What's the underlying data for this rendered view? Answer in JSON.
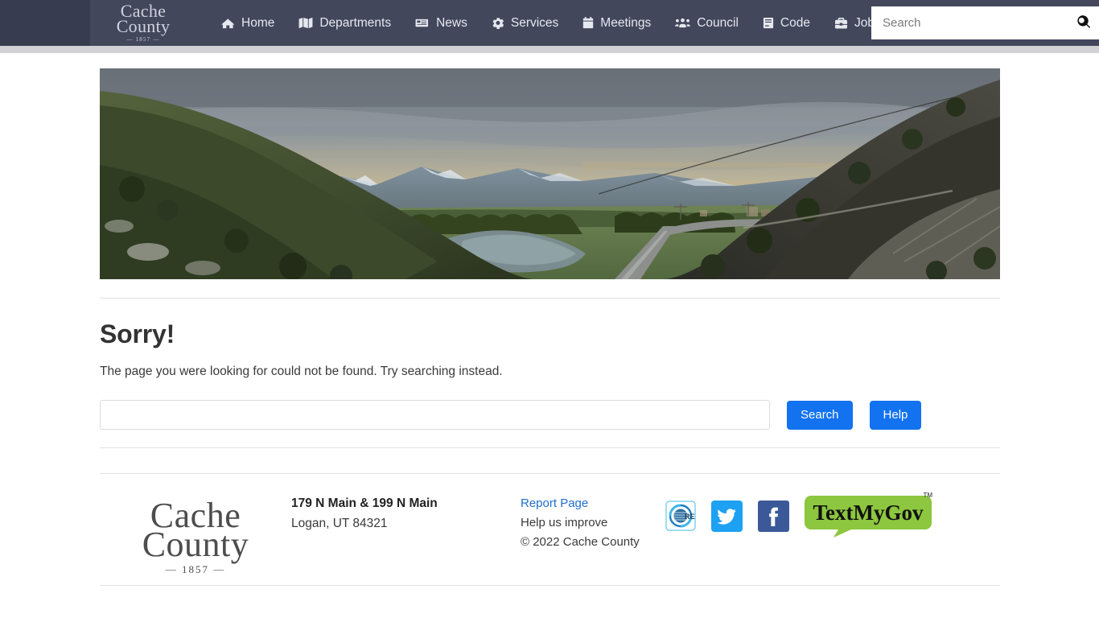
{
  "site": {
    "brand_line1": "Cache",
    "brand_line2": "County",
    "brand_year": "— 1857 —"
  },
  "nav": {
    "items": [
      {
        "label": "Home",
        "icon": "home-icon"
      },
      {
        "label": "Departments",
        "icon": "map-icon"
      },
      {
        "label": "News",
        "icon": "newspaper-icon"
      },
      {
        "label": "Services",
        "icon": "gear-icon"
      },
      {
        "label": "Meetings",
        "icon": "calendar-icon"
      },
      {
        "label": "Council",
        "icon": "users-icon"
      },
      {
        "label": "Code",
        "icon": "book-icon"
      },
      {
        "label": "Jobs",
        "icon": "briefcase-icon"
      }
    ],
    "search": {
      "placeholder": "Search",
      "value": "",
      "button_icon": "search-icon"
    }
  },
  "hero": {
    "alt": "Sunset over a canyon with green hillsides, a river, a highway and distant snow-capped mountains"
  },
  "main": {
    "heading": "Sorry!",
    "message": "The page you were looking for could not be found. Try searching instead.",
    "search_value": "",
    "search_placeholder": "",
    "search_button": "Search",
    "help_button": "Help"
  },
  "footer": {
    "logo_line1": "Cache",
    "logo_line2": "County",
    "logo_year": "— 1857 —",
    "address_line1": "179 N Main & 199 N Main",
    "address_line2": "Logan, UT 84321",
    "report_link": "Report Page",
    "help_text": "Help us improve",
    "copyright": "© 2022 Cache County",
    "social": [
      {
        "name": "core-icon",
        "label": "CORE"
      },
      {
        "name": "twitter-icon",
        "label": "Twitter"
      },
      {
        "name": "facebook-icon",
        "label": "Facebook"
      },
      {
        "name": "textmygov-icon",
        "label": "TextMyGov",
        "tm": "TM"
      }
    ]
  },
  "colors": {
    "nav_bg": "#43475c",
    "nav_bg_dark": "#383c51",
    "underbar": "#d2d2d4",
    "button_blue": "#1272f0",
    "link_blue": "#1f6fd0",
    "twitter_blue": "#1da1f2",
    "facebook_blue": "#3b5998",
    "textmygov_green": "#8dc63f"
  }
}
